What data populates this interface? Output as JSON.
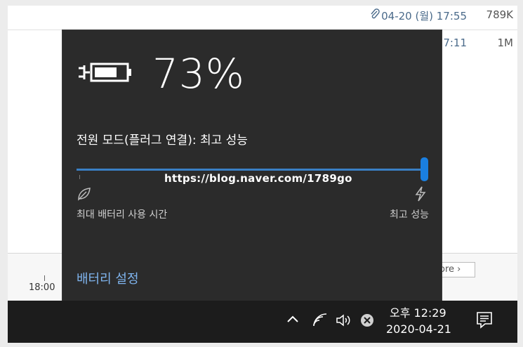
{
  "background_app": {
    "rows": [
      {
        "date": "04-20 (월) 17:55",
        "size": "789K"
      },
      {
        "date": "7:11",
        "size": "1M"
      }
    ],
    "time_axis_label": "18:00",
    "more_button": "ore ›"
  },
  "battery_flyout": {
    "percent": "73%",
    "level": 0.73,
    "power_mode_label": "전원 모드(플러그 연결): 최고 성능",
    "slider_value": 1.0,
    "left_label": "최대 배터리 사용 시간",
    "right_label": "최고 성능",
    "watermark": "https://blog.naver.com/1789go",
    "settings_link": "배터리 설정"
  },
  "taskbar": {
    "time": "오후 12:29",
    "date": "2020-04-21"
  },
  "colors": {
    "flyout_bg": "#2b2b2b",
    "accent": "#1a7fe0",
    "link": "#7fb4ee",
    "taskbar_bg": "#1c1c1c"
  }
}
